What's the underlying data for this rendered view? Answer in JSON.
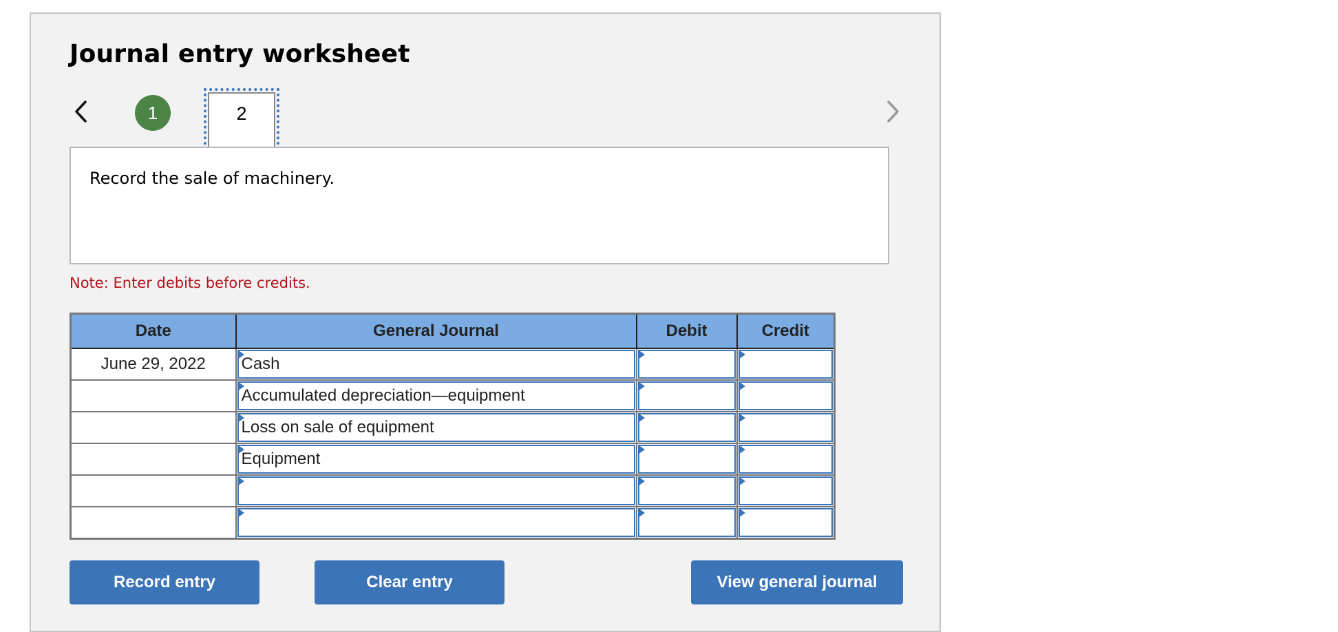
{
  "worksheet": {
    "title": "Journal entry worksheet",
    "nav": {
      "prev_icon": "chevron-left-icon",
      "next_icon": "chevron-right-icon",
      "steps": [
        {
          "label": "1",
          "status": "completed",
          "color": "#4b8445"
        },
        {
          "label": "2",
          "status": "current"
        }
      ]
    },
    "prompt": "Record the sale of machinery.",
    "note": "Note: Enter debits before credits.",
    "note_color": "#b3121a"
  },
  "journal": {
    "headers": [
      "Date",
      "General Journal",
      "Debit",
      "Credit"
    ],
    "header_color": "#7aace3",
    "rows": [
      {
        "date": "June 29, 2022",
        "account": "Cash",
        "debit": "",
        "credit": ""
      },
      {
        "date": "",
        "account": "Accumulated depreciation—equipment",
        "debit": "",
        "credit": ""
      },
      {
        "date": "",
        "account": "Loss on sale of equipment",
        "debit": "",
        "credit": ""
      },
      {
        "date": "",
        "account": "Equipment",
        "debit": "",
        "credit": ""
      },
      {
        "date": "",
        "account": "",
        "debit": "",
        "credit": ""
      },
      {
        "date": "",
        "account": "",
        "debit": "",
        "credit": ""
      }
    ]
  },
  "buttons": {
    "record": "Record entry",
    "clear": "Clear entry",
    "view": "View general journal",
    "color": "#3c74b8"
  }
}
